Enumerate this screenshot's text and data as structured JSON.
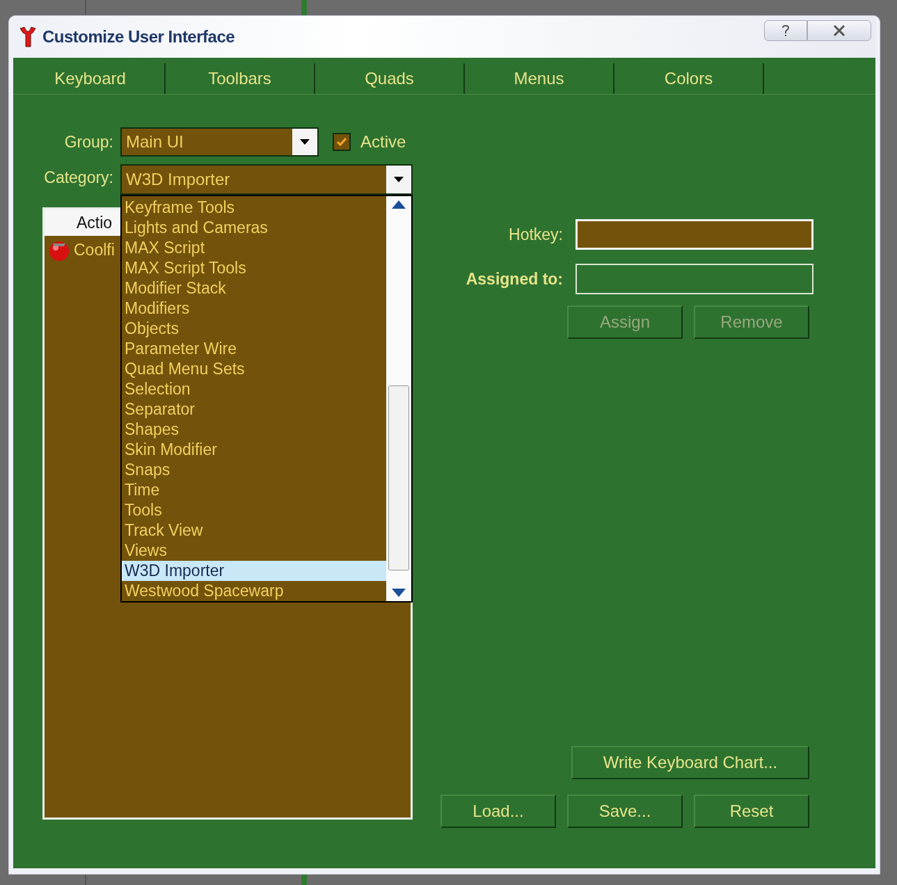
{
  "window": {
    "title": "Customize User Interface"
  },
  "tabs": [
    {
      "label": "Keyboard"
    },
    {
      "label": "Toolbars"
    },
    {
      "label": "Quads"
    },
    {
      "label": "Menus"
    },
    {
      "label": "Colors"
    }
  ],
  "group": {
    "label": "Group:",
    "value": "Main UI"
  },
  "active": {
    "label": "Active",
    "checked": true
  },
  "category": {
    "label": "Category:",
    "value": "W3D Importer",
    "expanded": true,
    "options": [
      {
        "label": "Keyframe Tools",
        "selected": false
      },
      {
        "label": "Lights and Cameras",
        "selected": false
      },
      {
        "label": "MAX Script",
        "selected": false
      },
      {
        "label": "MAX Script Tools",
        "selected": false
      },
      {
        "label": "Modifier Stack",
        "selected": false
      },
      {
        "label": "Modifiers",
        "selected": false
      },
      {
        "label": "Objects",
        "selected": false
      },
      {
        "label": "Parameter Wire",
        "selected": false
      },
      {
        "label": "Quad Menu Sets",
        "selected": false
      },
      {
        "label": "Selection",
        "selected": false
      },
      {
        "label": "Separator",
        "selected": false
      },
      {
        "label": "Shapes",
        "selected": false
      },
      {
        "label": "Skin Modifier",
        "selected": false
      },
      {
        "label": "Snaps",
        "selected": false
      },
      {
        "label": "Time",
        "selected": false
      },
      {
        "label": "Tools",
        "selected": false
      },
      {
        "label": "Track View",
        "selected": false
      },
      {
        "label": "Views",
        "selected": false
      },
      {
        "label": "W3D Importer",
        "selected": true
      },
      {
        "label": "Westwood Spacewarp",
        "selected": false
      }
    ]
  },
  "actions": {
    "column_header": "Actio",
    "rows": [
      {
        "label": "Coolfi"
      }
    ]
  },
  "hotkey": {
    "label": "Hotkey:"
  },
  "assigned_to": {
    "label": "Assigned to:"
  },
  "assign_buttons": [
    {
      "label": "Assign",
      "disabled": true
    },
    {
      "label": "Remove",
      "disabled": true
    }
  ],
  "chart_button": {
    "label": "Write Keyboard Chart...",
    "disabled": false
  },
  "file_buttons": [
    {
      "label": "Load...",
      "disabled": false
    },
    {
      "label": "Save...",
      "disabled": false
    },
    {
      "label": "Reset",
      "disabled": false
    }
  ]
}
